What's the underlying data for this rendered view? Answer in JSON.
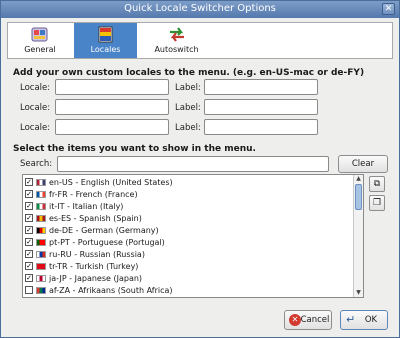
{
  "window": {
    "title": "Quick Locale Switcher Options"
  },
  "tabs": [
    {
      "label": "General",
      "icon": "qls-icon",
      "active": false
    },
    {
      "label": "Locales",
      "icon": "flags-icon",
      "active": true
    },
    {
      "label": "Autoswitch",
      "icon": "sync-arrows-icon",
      "active": false
    }
  ],
  "custom": {
    "heading": "Add your own custom locales to the menu. (e.g. en-US-mac or de-FY)",
    "locale_label": "Locale:",
    "label_label": "Label:",
    "rows": [
      {
        "locale": "",
        "label": ""
      },
      {
        "locale": "",
        "label": ""
      },
      {
        "locale": "",
        "label": ""
      }
    ]
  },
  "items": {
    "heading": "Select the items you want to show in the menu.",
    "search_label": "Search:",
    "search_value": "",
    "clear_label": "Clear",
    "list": [
      {
        "text": "en-US - English (United States)",
        "checked": true,
        "flag_colors": [
          "#b22234",
          "#ffffff",
          "#3c3b6e"
        ]
      },
      {
        "text": "fr-FR - French (France)",
        "checked": true,
        "flag_colors": [
          "#0055a4",
          "#ffffff",
          "#ef4135"
        ]
      },
      {
        "text": "it-IT - Italian (Italy)",
        "checked": true,
        "flag_colors": [
          "#009246",
          "#ffffff",
          "#ce2b37"
        ]
      },
      {
        "text": "es-ES - Spanish (Spain)",
        "checked": true,
        "flag_colors": [
          "#aa151b",
          "#f1bf00",
          "#aa151b"
        ]
      },
      {
        "text": "de-DE - German (Germany)",
        "checked": true,
        "flag_colors": [
          "#000000",
          "#dd0000",
          "#ffce00"
        ]
      },
      {
        "text": "pt-PT - Portuguese (Portugal)",
        "checked": true,
        "flag_colors": [
          "#006600",
          "#ff0000",
          "#ff0000"
        ]
      },
      {
        "text": "ru-RU - Russian (Russia)",
        "checked": true,
        "flag_colors": [
          "#ffffff",
          "#0039a6",
          "#d52b1e"
        ]
      },
      {
        "text": "tr-TR - Turkish (Turkey)",
        "checked": true,
        "flag_colors": [
          "#e30a17",
          "#e30a17",
          "#e30a17"
        ]
      },
      {
        "text": "ja-JP - Japanese (Japan)",
        "checked": true,
        "flag_colors": [
          "#ffffff",
          "#bc002d",
          "#ffffff"
        ]
      },
      {
        "text": "af-ZA - Afrikaans (South Africa)",
        "checked": false,
        "flag_colors": [
          "#de3831",
          "#007a4d",
          "#002395"
        ]
      }
    ]
  },
  "side_buttons": [
    {
      "icon": "select-all-icon"
    },
    {
      "icon": "deselect-all-icon"
    }
  ],
  "footer": {
    "cancel_label": "Cancel",
    "ok_label": "OK"
  },
  "colors": {
    "accent": "#4a84c8",
    "title_bar": "#5479ad"
  }
}
